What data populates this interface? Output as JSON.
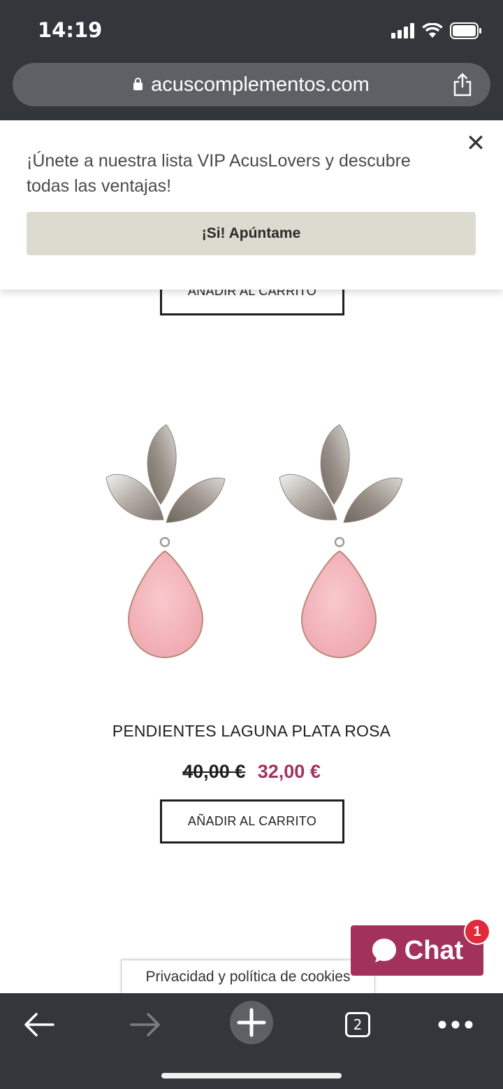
{
  "status": {
    "time": "14:19"
  },
  "browser": {
    "url": "acuscomplementos.com",
    "tabs_count": "2"
  },
  "popup": {
    "message": "¡Únete a nuestra lista VIP AcusLovers y descubre todas las ventajas!",
    "button_label": "¡Si! Apúntame",
    "close_label": "✕"
  },
  "partial_cart_button": {
    "label": "AÑADIR AL CARRITO"
  },
  "product": {
    "title": "PENDIENTES LAGUNA PLATA ROSA",
    "old_price": "40,00 €",
    "new_price": "32,00 €",
    "cart_label": "AÑADIR AL CARRITO"
  },
  "cookies": {
    "label": "Privacidad y política de cookies"
  },
  "chat": {
    "label": "Chat",
    "badge": "1"
  },
  "colors": {
    "accent": "#a3325b",
    "browser_chrome": "#33363b",
    "popup_button": "#dcdbd0",
    "stone": "#f3b7bd"
  }
}
